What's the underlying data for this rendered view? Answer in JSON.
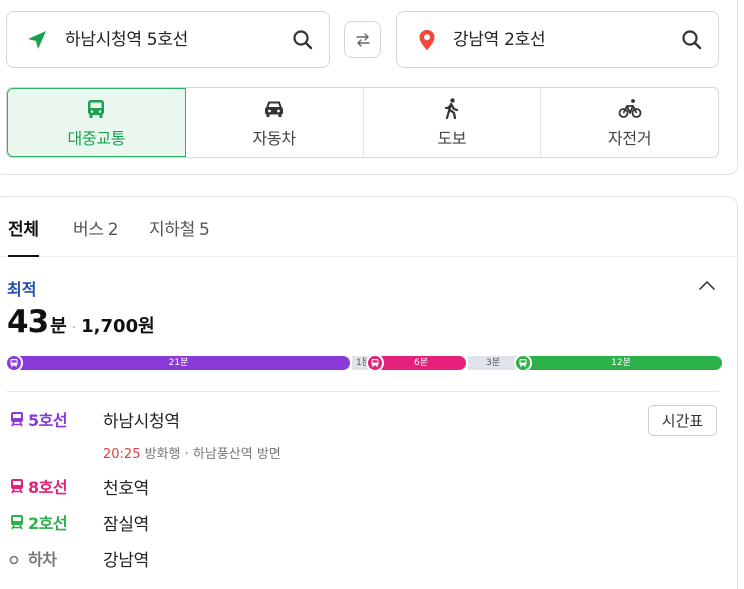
{
  "route": {
    "from": {
      "label": "하남시청역 5호선"
    },
    "to": {
      "label": "강남역 2호선"
    }
  },
  "modes": [
    {
      "label": "대중교통",
      "icon": "bus-icon",
      "active": true
    },
    {
      "label": "자동차",
      "icon": "car-icon",
      "active": false
    },
    {
      "label": "도보",
      "icon": "walk-icon",
      "active": false
    },
    {
      "label": "자전거",
      "icon": "bicycle-icon",
      "active": false
    }
  ],
  "filters": {
    "all": "전체",
    "bus": "버스",
    "bus_count": "2",
    "subway": "지하철",
    "subway_count": "5"
  },
  "result": {
    "badge": "최적",
    "minutes": "43",
    "minutes_unit": "분",
    "fare": "1,700원",
    "timetable_label": "시간표",
    "segments": [
      {
        "type": "subway",
        "label": "21분",
        "color": "#8a3ad7"
      },
      {
        "type": "walk",
        "label": "1분"
      },
      {
        "type": "subway",
        "label": "6분",
        "color": "#e4207a"
      },
      {
        "type": "walk",
        "label": "3분"
      },
      {
        "type": "subway",
        "label": "12분",
        "color": "#2bb04a"
      }
    ],
    "steps": [
      {
        "line": "5호선",
        "station": "하남시청역",
        "color": "#8a3ad7"
      },
      {
        "line": "8호선",
        "station": "천호역",
        "color": "#e4207a"
      },
      {
        "line": "2호선",
        "station": "잠실역",
        "color": "#2bb04a"
      },
      {
        "line": "하차",
        "station": "강남역",
        "color": "#777777"
      }
    ],
    "detail": {
      "time": "20:25",
      "text": "방화행 · 하남풍산역 방면"
    }
  },
  "colors": {
    "accent": "#1aa052",
    "best": "#1f4fa8",
    "line5": "#8a3ad7",
    "line8": "#e4207a",
    "line2": "#2bb04a"
  }
}
